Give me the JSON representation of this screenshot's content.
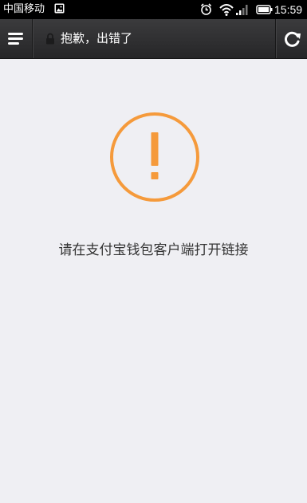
{
  "status_bar": {
    "carrier": "中国移动",
    "time": "15:59",
    "icons": [
      "gallery-icon",
      "alarm-icon",
      "wifi-icon",
      "signal-icon",
      "battery-icon"
    ]
  },
  "title_bar": {
    "title": "抱歉，出错了",
    "icons": [
      "menu-icon",
      "lock-icon",
      "refresh-icon"
    ]
  },
  "content": {
    "message": "请在支付宝钱包客户端打开链接",
    "icon": "exclamation-circle-icon",
    "accent_color": "#f59a3b"
  }
}
